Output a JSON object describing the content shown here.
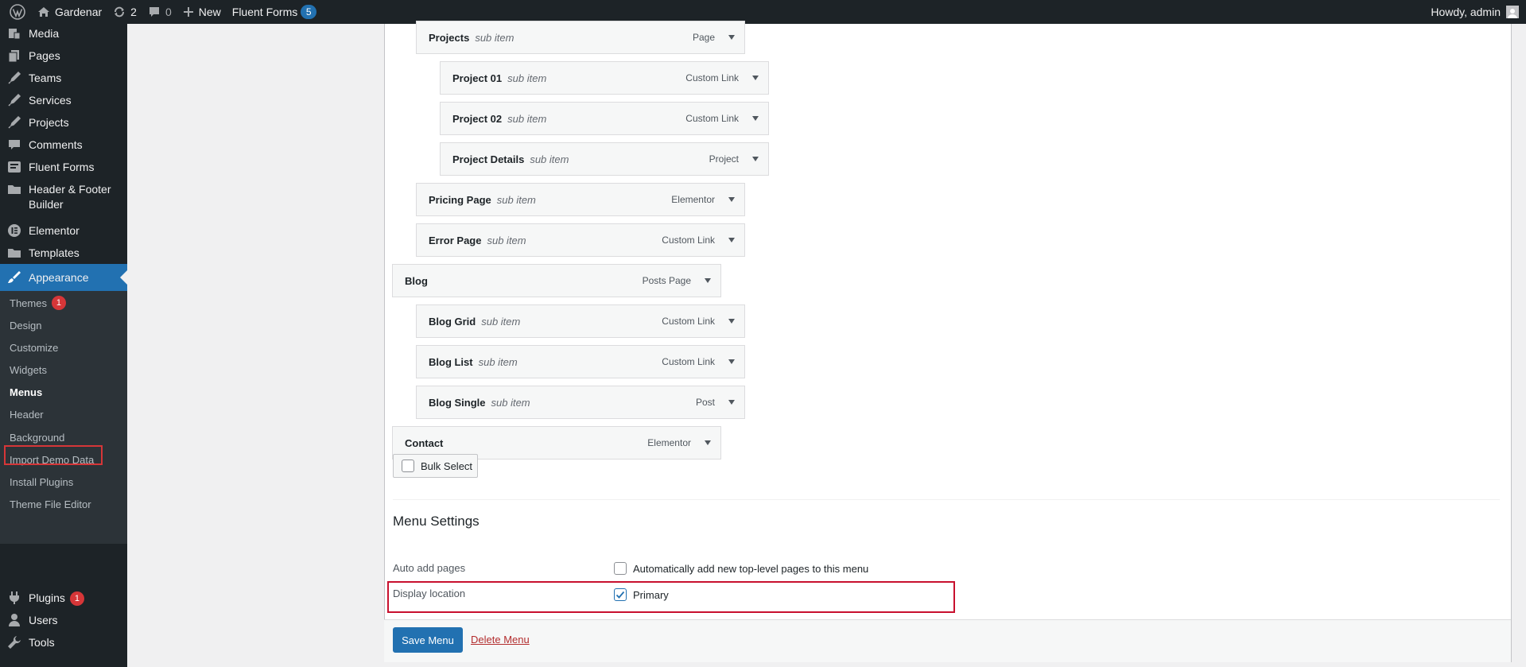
{
  "adminbar": {
    "site_name": "Gardenar",
    "updates_count": "2",
    "comments_count": "0",
    "new_label": "New",
    "fluent_forms_label": "Fluent Forms",
    "fluent_forms_count": "5",
    "howdy": "Howdy, admin"
  },
  "sidebar": {
    "items": [
      {
        "label": "Media",
        "icon": "media-icon"
      },
      {
        "label": "Pages",
        "icon": "pages-icon"
      },
      {
        "label": "Teams",
        "icon": "pin-icon"
      },
      {
        "label": "Services",
        "icon": "pin-icon"
      },
      {
        "label": "Projects",
        "icon": "pin-icon"
      },
      {
        "label": "Comments",
        "icon": "comment-icon"
      },
      {
        "label": "Fluent Forms",
        "icon": "forms-icon"
      },
      {
        "label": "Header & Footer Builder",
        "icon": "folder-icon"
      },
      {
        "label": "Elementor",
        "icon": "elementor-icon"
      },
      {
        "label": "Templates",
        "icon": "folder-icon"
      },
      {
        "label": "Appearance",
        "icon": "brush-icon"
      },
      {
        "label": "Plugins",
        "icon": "plugin-icon",
        "badge": "1"
      },
      {
        "label": "Users",
        "icon": "users-icon"
      },
      {
        "label": "Tools",
        "icon": "tools-icon"
      }
    ],
    "submenu": [
      {
        "label": "Themes",
        "badge": "1"
      },
      {
        "label": "Design"
      },
      {
        "label": "Customize"
      },
      {
        "label": "Widgets"
      },
      {
        "label": "Menus"
      },
      {
        "label": "Header"
      },
      {
        "label": "Background"
      },
      {
        "label": "Import Demo Data"
      },
      {
        "label": "Install Plugins"
      },
      {
        "label": "Theme File Editor"
      }
    ]
  },
  "menu_items": [
    {
      "title": "Projects",
      "sub": "sub item",
      "type": "Page"
    },
    {
      "title": "Project 01",
      "sub": "sub item",
      "type": "Custom Link"
    },
    {
      "title": "Project 02",
      "sub": "sub item",
      "type": "Custom Link"
    },
    {
      "title": "Project Details",
      "sub": "sub item",
      "type": "Project"
    },
    {
      "title": "Pricing Page",
      "sub": "sub item",
      "type": "Elementor"
    },
    {
      "title": "Error Page",
      "sub": "sub item",
      "type": "Custom Link"
    },
    {
      "title": "Blog",
      "sub": "",
      "type": "Posts Page"
    },
    {
      "title": "Blog Grid",
      "sub": "sub item",
      "type": "Custom Link"
    },
    {
      "title": "Blog List",
      "sub": "sub item",
      "type": "Custom Link"
    },
    {
      "title": "Blog Single",
      "sub": "sub item",
      "type": "Post"
    },
    {
      "title": "Contact",
      "sub": "",
      "type": "Elementor"
    }
  ],
  "bulk_select_label": "Bulk Select",
  "menu_settings": {
    "heading": "Menu Settings",
    "auto_add_label": "Auto add pages",
    "auto_add_option": "Automatically add new top-level pages to this menu",
    "display_location_label": "Display location",
    "primary_option": "Primary"
  },
  "actions": {
    "save": "Save Menu",
    "delete": "Delete Menu"
  },
  "colors": {
    "admin_dark": "#1d2327",
    "accent_blue": "#2271b1",
    "badge_red": "#d63638",
    "highlight_red": "#c8102e"
  }
}
